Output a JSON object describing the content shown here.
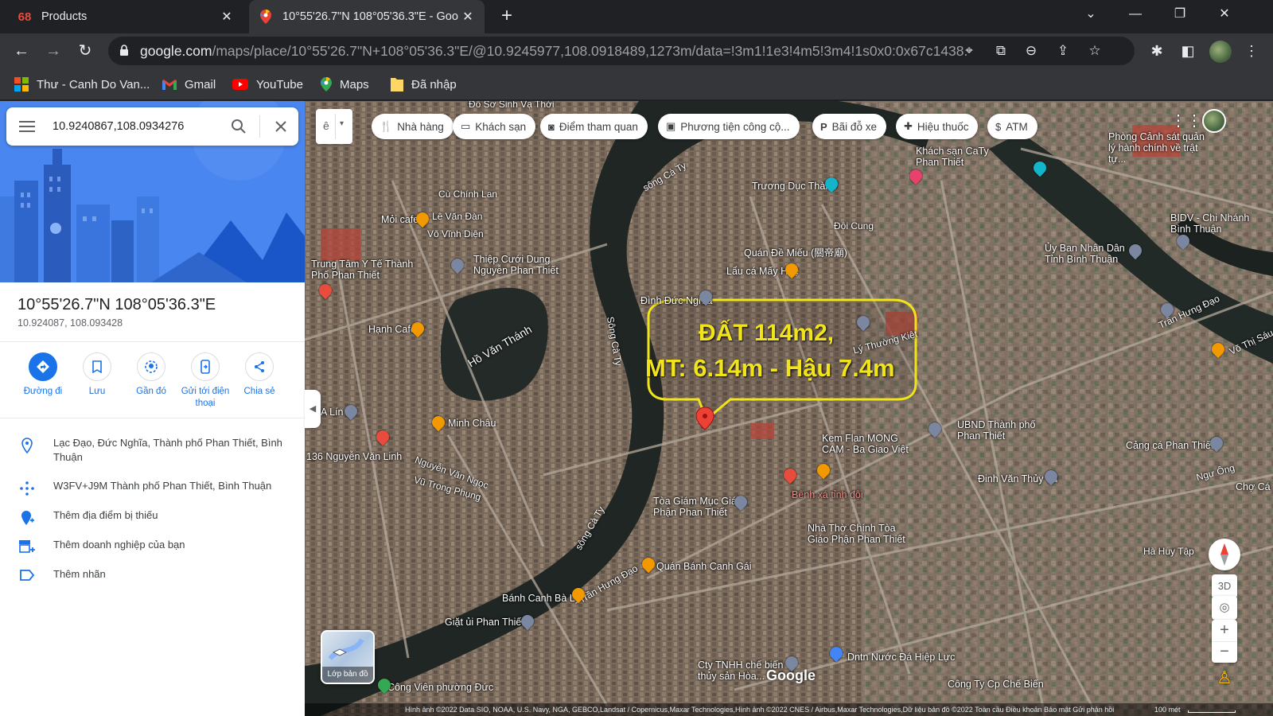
{
  "browser": {
    "tabs": [
      {
        "title": "Products",
        "favicon": "68"
      },
      {
        "title": "10°55'26.7\"N 108°05'36.3\"E - Goo",
        "favicon": "maps-pin-icon"
      }
    ],
    "url_host": "google.com",
    "url_path": "/maps/place/10°55'26.7\"N+108°05'36.3\"E/@10.9245977,108.0918489,1273m/data=!3m1!1e3!4m5!3m4!1s0x0:0x67c1438...",
    "bookmarks": [
      {
        "label": "Thư - Canh Do Van...",
        "icon": "microsoft-icon"
      },
      {
        "label": "Gmail",
        "icon": "gmail-icon"
      },
      {
        "label": "YouTube",
        "icon": "youtube-icon"
      },
      {
        "label": "Maps",
        "icon": "maps-icon"
      },
      {
        "label": "Đã nhập",
        "icon": "folder-icon"
      }
    ]
  },
  "sidebar": {
    "search_value": "10.9240867,108.0934276",
    "place_title": "10°55'26.7\"N 108°05'36.3\"E",
    "place_coords": "10.924087, 108.093428",
    "actions": [
      {
        "label": "Đường đi",
        "icon": "directions-icon"
      },
      {
        "label": "Lưu",
        "icon": "bookmark-icon"
      },
      {
        "label": "Gần đó",
        "icon": "nearby-icon"
      },
      {
        "label": "Gửi tới điện thoại",
        "icon": "send-to-phone-icon"
      },
      {
        "label": "Chia sẻ",
        "icon": "share-icon"
      }
    ],
    "info": [
      {
        "text": "Lạc Đạo, Đức Nghĩa, Thành phố Phan Thiết, Bình Thuận",
        "icon": "location-pin-icon"
      },
      {
        "text": "W3FV+J9M Thành phố Phan Thiết, Bình Thuận",
        "icon": "plus-code-icon"
      },
      {
        "text": "Thêm địa điểm bị thiếu",
        "icon": "add-place-icon"
      },
      {
        "text": "Thêm doanh nghiệp của bạn",
        "icon": "add-business-icon"
      },
      {
        "text": "Thêm nhãn",
        "icon": "label-icon"
      }
    ]
  },
  "map": {
    "mode_label": "ê",
    "chips": [
      {
        "label": "Nhà hàng",
        "icon": "restaurant-icon"
      },
      {
        "label": "Khách sạn",
        "icon": "hotel-icon"
      },
      {
        "label": "Điểm tham quan",
        "icon": "camera-icon"
      },
      {
        "label": "Phương tiện công cộ...",
        "icon": "transit-icon"
      },
      {
        "label": "Bãi đỗ xe",
        "icon": "parking-icon"
      },
      {
        "label": "Hiệu thuốc",
        "icon": "pharmacy-icon"
      },
      {
        "label": "ATM",
        "icon": "atm-icon"
      }
    ],
    "callout_line1": "ĐẤT 114m2,",
    "callout_line2": "MT: 6.14m - Hậu 7.4m",
    "layers_label": "Lớp bản đồ",
    "google_logo": "Google",
    "controls": {
      "three_d": "3D"
    },
    "attribution": "Hình ảnh ©2022 Data SIO, NOAA, U.S. Navy, NGA, GEBCO,Landsat / Copernicus,Maxar Technologies,Hình ảnh ©2022 CNES / Airbus,Maxar Technologies,Dữ liệu bản đồ ©2022   Toàn cầu   Điều khoản   Bảo mật   Gửi phản hồi",
    "scale": "100 mét",
    "labels": [
      {
        "text": "Đỗ Sơ Sinh Vạ Thới",
        "cls": "road"
      },
      {
        "text": "sông Cà Ty",
        "cls": "road"
      },
      {
        "text": "Trương Dục Thành",
        "cls": "poi"
      },
      {
        "text": "Khách sạn CaTy Phan Thiết",
        "cls": "poi"
      },
      {
        "text": "Đội Cung",
        "cls": "road"
      },
      {
        "text": "Quán Đề Miếu (關帝廟)",
        "cls": "poi"
      },
      {
        "text": "Lẩu cá Mấy Huệ",
        "cls": "poi"
      },
      {
        "text": "Đình Đức Nghĩa",
        "cls": "poi"
      },
      {
        "text": "Cù Chính Lan",
        "cls": "road"
      },
      {
        "text": "Mỏi cafe",
        "cls": "poi"
      },
      {
        "text": "Lê Văn Đàn",
        "cls": "road"
      },
      {
        "text": "Võ Vĩnh Diện",
        "cls": "road"
      },
      {
        "text": "Thiệp Cưới Dung Nguyễn Phan Thiết",
        "cls": "poi"
      },
      {
        "text": "Trung Tâm Y Tế Thành Phố Phan Thiết",
        "cls": "poi"
      },
      {
        "text": "Hồ Văn Thánh",
        "cls": "poi"
      },
      {
        "text": "Hạnh Cafe",
        "cls": "poi"
      },
      {
        "text": "Sông Cà Ty",
        "cls": "road"
      },
      {
        "text": "Minh Châu",
        "cls": "poi"
      },
      {
        "text": "A Lín",
        "cls": "poi"
      },
      {
        "text": "136 Nguyễn Văn Linh",
        "cls": "poi"
      },
      {
        "text": "Nguyễn Văn Ngọc",
        "cls": "road"
      },
      {
        "text": "Vũ Trọng Phụng",
        "cls": "road"
      },
      {
        "text": "sông Cà Ty",
        "cls": "road"
      },
      {
        "text": "Quán Bánh Canh Gái",
        "cls": "poi"
      },
      {
        "text": "Bánh Canh Bà Lý",
        "cls": "poi"
      },
      {
        "text": "Giặt ủi Phan Thiết",
        "cls": "poi"
      },
      {
        "text": "Tòa Giám Mục Giáo Phận Phan Thiết",
        "cls": "poi"
      },
      {
        "text": "Bệnh xá tỉnh đội",
        "cls": "red"
      },
      {
        "text": "Nhà Thờ Chính Tòa Giáo Phận Phan Thiết",
        "cls": "poi"
      },
      {
        "text": "Kem Flan MONG CAM - Ba Giao Việt",
        "cls": "poi"
      },
      {
        "text": "UBND Thành phố Phan Thiết",
        "cls": "poi"
      },
      {
        "text": "Đinh Văn Thủy Tú",
        "cls": "poi"
      },
      {
        "text": "Cảng cá Phan Thiết",
        "cls": "poi"
      },
      {
        "text": "Hà Huy Tập",
        "cls": "road"
      },
      {
        "text": "Ủy Ban Nhân Dân Tỉnh Bình Thuận",
        "cls": "poi"
      },
      {
        "text": "BIDV - Chi Nhánh Bình Thuận",
        "cls": "poi"
      },
      {
        "text": "Phòng Cảnh sát quản lý hành chính về trật tự...",
        "cls": "poi"
      },
      {
        "text": "Trần Hưng Đạo",
        "cls": "road"
      },
      {
        "text": "Ngư Ông",
        "cls": "road"
      },
      {
        "text": "Dntn Nước Đá Hiệp Lực",
        "cls": "poi"
      },
      {
        "text": "Cty TNHH chế biến thủy sản Hòa...",
        "cls": "poi"
      },
      {
        "text": "Công Ty Cp Chế Biến",
        "cls": "poi"
      },
      {
        "text": "Công Viên phường Đức",
        "cls": "poi"
      },
      {
        "text": "Lý Thường Kiệt",
        "cls": "road"
      },
      {
        "text": "Trần Hưng Đạo",
        "cls": "road"
      },
      {
        "text": "Chợ Cá",
        "cls": "poi"
      },
      {
        "text": "Võ Thị Sáu",
        "cls": "road"
      }
    ]
  }
}
